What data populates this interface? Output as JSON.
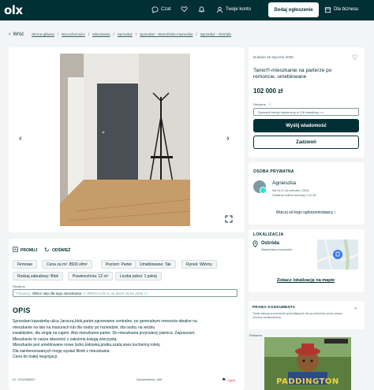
{
  "header": {
    "logo": "olx",
    "chat_label": "Czat",
    "account_label": "Twoje konto",
    "add_button": "Dodaj ogłoszenie",
    "business_label": "Dla biznesu"
  },
  "breadcrumb": {
    "back_label": "Wróć",
    "items": [
      "Strona główna",
      "Nieruchomości",
      "Mieszkania",
      "Sprzedaż",
      "Sprzedaż - Warmińsko-mazurskie",
      "Sprzedaż - Ostróda"
    ]
  },
  "listing": {
    "date": "Dodane 15 stycznia 2026",
    "title": "Tanio!!!-mieszkanie na parterze po remoncie, umeblowane",
    "price": "102 000 zł",
    "rate_label": "Rodzaj",
    "rate_select": "Sprawdź kredyt hipoteczny w Citi Handlowy >>",
    "message_button": "Wyślij wiadomość",
    "call_button": "Zadzwoń",
    "promote_label": "PROMUJ",
    "refresh_label": "ODŚWIEŻ",
    "tags_row1": [
      "Firmowe",
      "Cena za m²: 8500 zł/m²",
      "Poziom: Parter",
      "Umeblowane: Tak",
      "Rynek: Wtórny"
    ],
    "tags_row2": [
      "Rodzaj zabudowy: Blok",
      "Powierzchnia: 12 m²",
      "Liczba pokoi: 1 pokój"
    ],
    "ad_label": "Reklama",
    "rel_prefix": "Finansuj",
    "rel_main": "Oblicz ratę dla tego mieszkania",
    "rel_suffix": ">> RRSO 6,25 % na dzień 15.01.2026",
    "rel_arrow": ">>",
    "description_title": "OPIS",
    "description_lines": [
      "Sprzedam kawalerkę-ulica Jaracza,blok,parter,ogrzewanie centralne, po generalnym remoncie-idealne na",
      "mieszkanie na lato na mazurach lub dla osoby po rozwodzie, dla osoby na wózku",
      "inwalidzkim, dla singla na najem. Atut mieszkanie-parter. Do mieszkania przynależy piwnica. Zapraszam.",
      "Mieszkanie to nasza własność z założona księgą wieczystą.",
      "Mieszkanie jest umeblowane nowe lozko,lodowka,pralka,szafa,anex kuchenny,rolety.",
      "Dla zainteresowanych mogę wysłać filmik z mieszkania.",
      "Cena do małej negocjacji."
    ],
    "ad_id": "ID: 1002958022",
    "views": "Wyświetlenia: 465",
    "report": "Zgłoś"
  },
  "seller": {
    "section_title": "OSOBA PRYWATNA",
    "name": "Agnieszka",
    "since": "Na OLX od czerwiec 2015",
    "last_online": "Ostatnio online wczoraj o 11:15",
    "more_link": "Więcej od tego ogłoszeniodawcy"
  },
  "location": {
    "section_title": "LOKALIZACJA",
    "city": "Ostróda",
    "region": "Warmińsko-mazurskie",
    "map_link": "Zobacz lokalizację na mapie"
  },
  "consumer": {
    "section_title": "PRAWA KONSUMENTA",
    "text": "Twoje zakupy w ponownie sprzedających nie są chronione przez prawo ochrony konsumentów",
    "ad_label": "Reklama",
    "ad_title": "PADDINGTON"
  },
  "colors": {
    "header_bg": "#002f34",
    "accent": "#23e5db",
    "page_bg": "#f2f4f5"
  }
}
